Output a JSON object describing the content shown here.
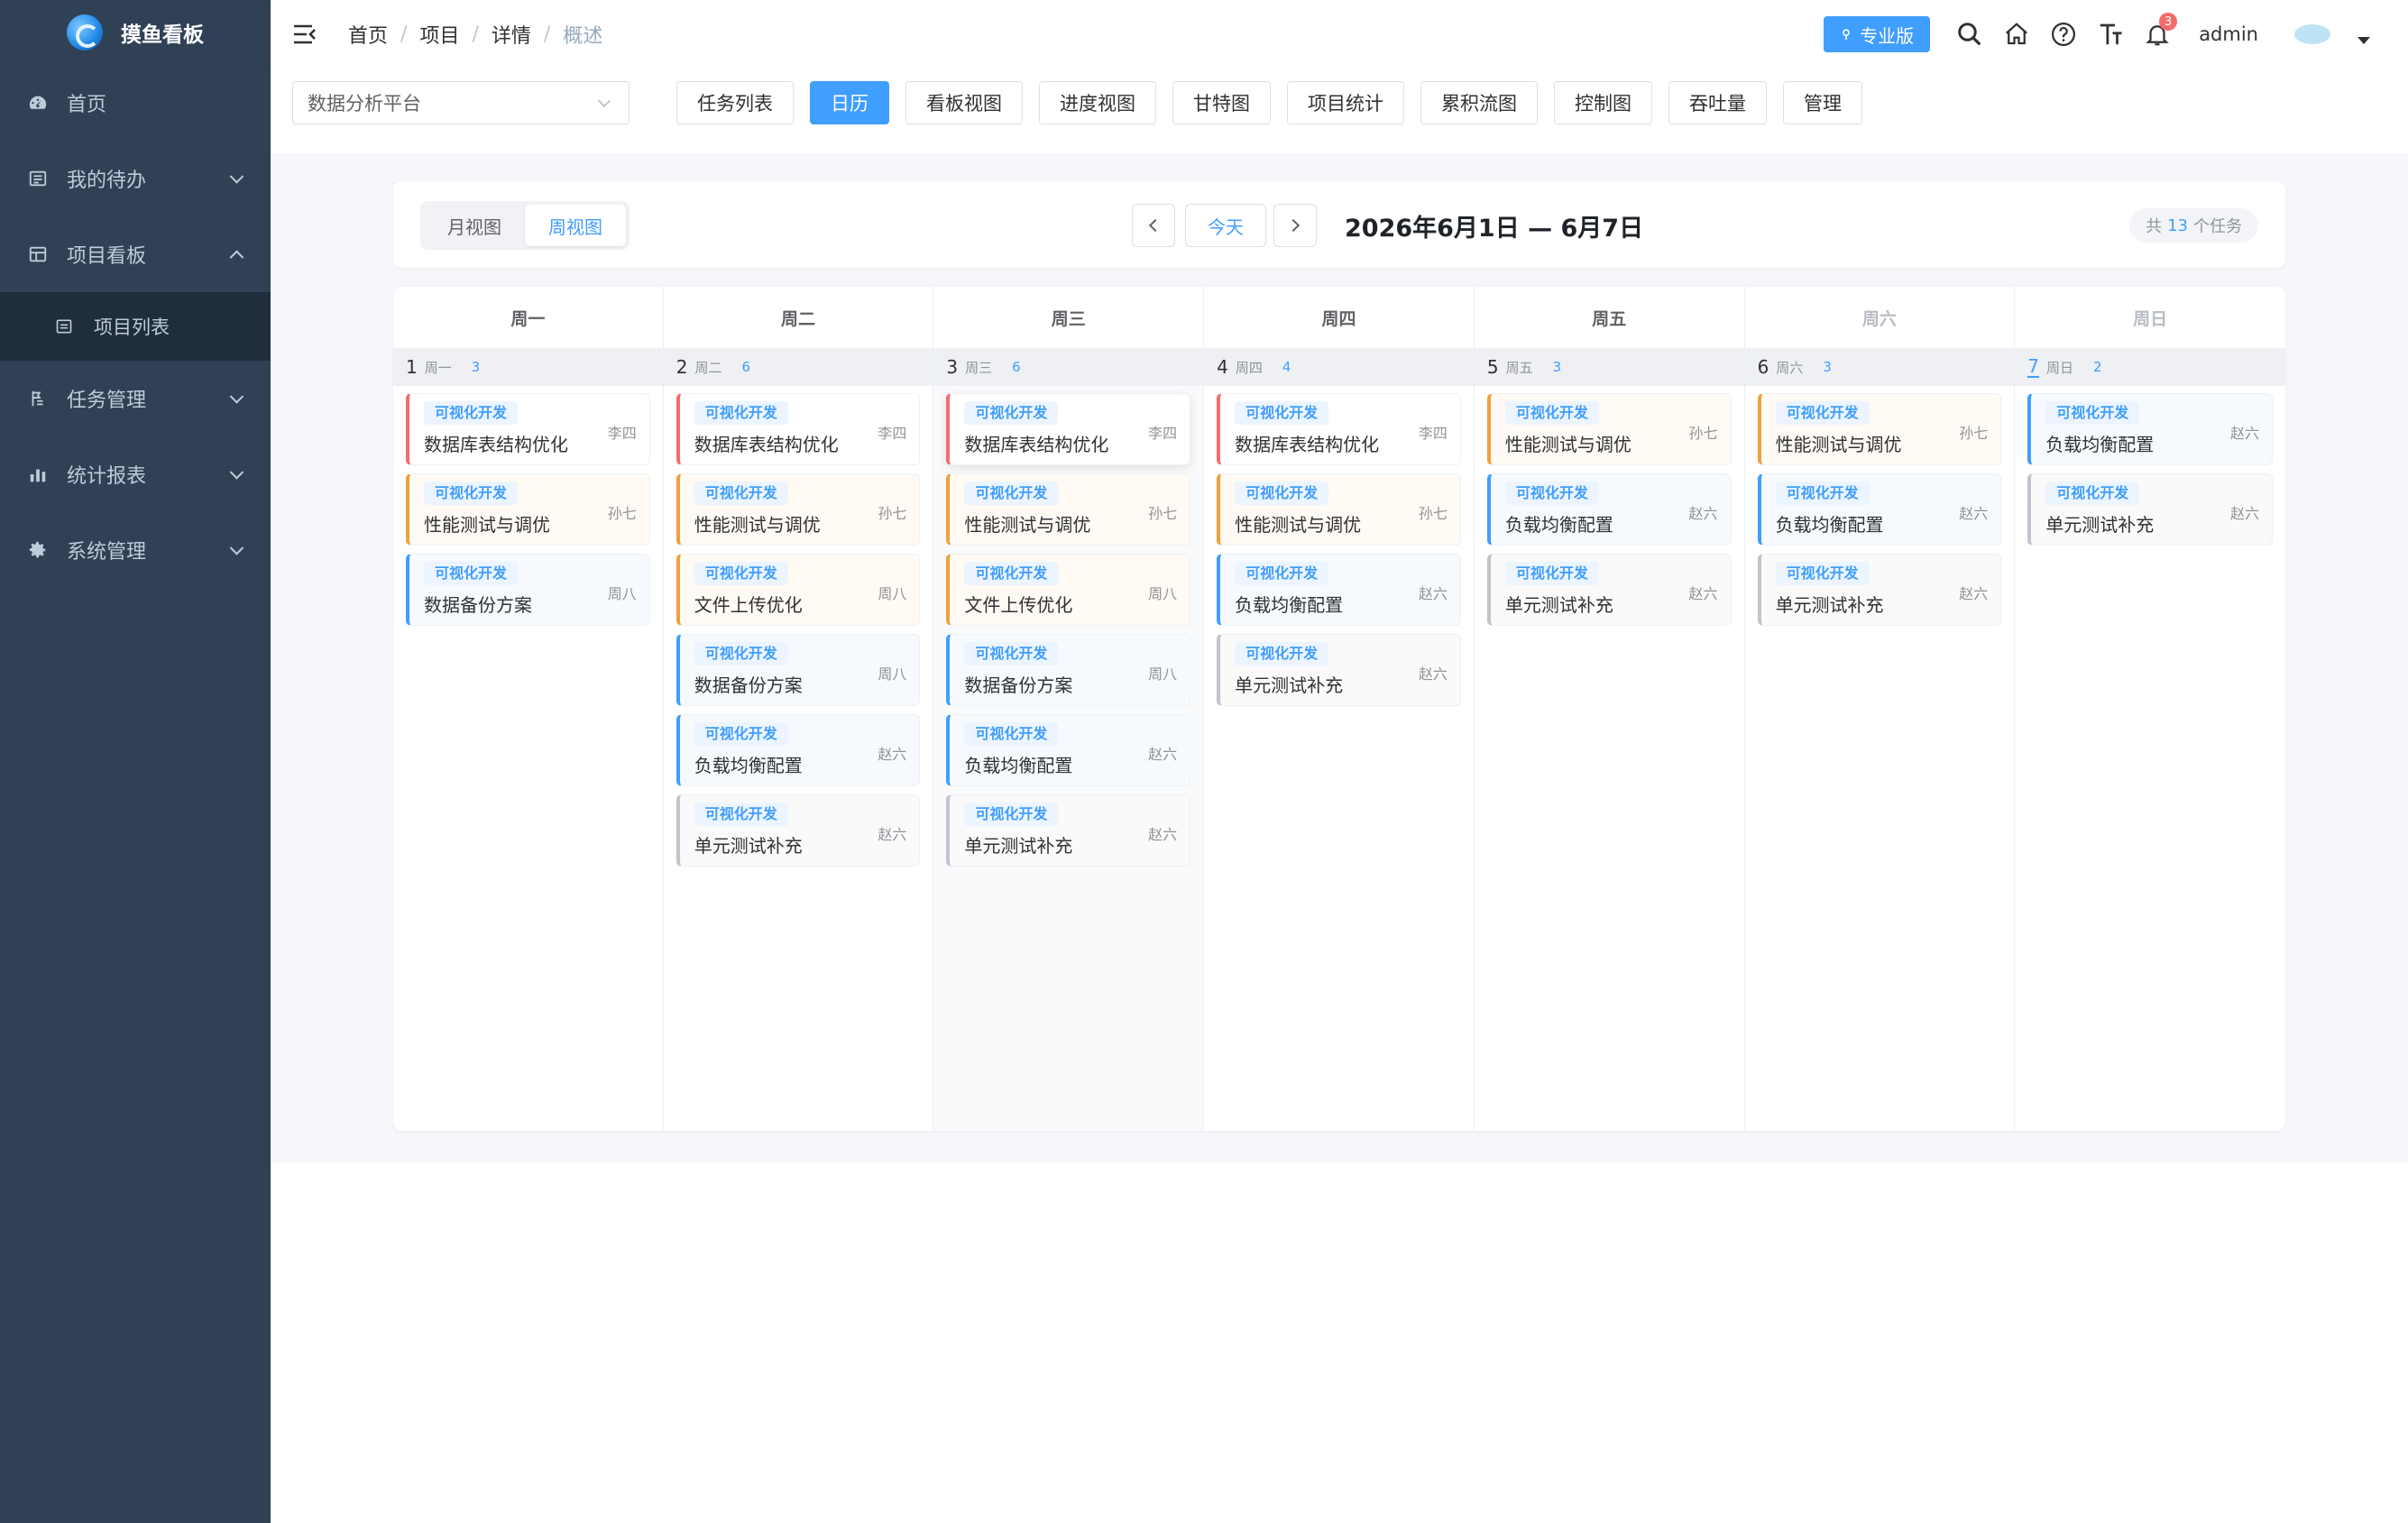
{
  "sidebar": {
    "logo_title": "摸鱼看板",
    "items": [
      {
        "label": "首页",
        "icon": "dashboard-icon"
      },
      {
        "label": "我的待办",
        "icon": "todo-icon"
      },
      {
        "label": "项目看板",
        "icon": "board-icon"
      },
      {
        "label": "项目列表",
        "icon": "list-icon"
      },
      {
        "label": "任务管理",
        "icon": "task-icon"
      },
      {
        "label": "统计报表",
        "icon": "chart-icon"
      },
      {
        "label": "系统管理",
        "icon": "gear-icon"
      }
    ]
  },
  "header": {
    "breadcrumb": [
      "首页",
      "项目",
      "详情",
      "概述"
    ],
    "separator": "/",
    "pro_label": "专业版",
    "notification_count": "3",
    "username": "admin"
  },
  "toolbar": {
    "project": "数据分析平台",
    "tabs": [
      "任务列表",
      "日历",
      "看板视图",
      "进度视图",
      "甘特图",
      "项目统计",
      "累积流图",
      "控制图",
      "吞吐量",
      "管理"
    ],
    "active_tab": "日历"
  },
  "calendar": {
    "view_month": "月视图",
    "view_week": "周视图",
    "active_view": "周视图",
    "today_label": "今天",
    "range": "2026年6月1日 — 6月7日",
    "count_prefix": "共",
    "count_value": "13",
    "count_suffix": "个任务",
    "days": [
      {
        "header": "周一",
        "date": "1",
        "weekday": "周一",
        "count": "3",
        "weekend": false,
        "current": false,
        "tasks": [
          {
            "tag": "可视化开发",
            "title": "数据库表结构优化",
            "assignee": "李四",
            "color": "#f56c6c"
          },
          {
            "tag": "可视化开发",
            "title": "性能测试与调优",
            "assignee": "孙七",
            "color": "#f0a13c"
          },
          {
            "tag": "可视化开发",
            "title": "数据备份方案",
            "assignee": "周八",
            "color": "#409eff"
          }
        ]
      },
      {
        "header": "周二",
        "date": "2",
        "weekday": "周二",
        "count": "6",
        "weekend": false,
        "current": false,
        "tasks": [
          {
            "tag": "可视化开发",
            "title": "数据库表结构优化",
            "assignee": "李四",
            "color": "#f56c6c"
          },
          {
            "tag": "可视化开发",
            "title": "性能测试与调优",
            "assignee": "孙七",
            "color": "#f0a13c"
          },
          {
            "tag": "可视化开发",
            "title": "文件上传优化",
            "assignee": "周八",
            "color": "#f0a13c"
          },
          {
            "tag": "可视化开发",
            "title": "数据备份方案",
            "assignee": "周八",
            "color": "#409eff"
          },
          {
            "tag": "可视化开发",
            "title": "负载均衡配置",
            "assignee": "赵六",
            "color": "#409eff"
          },
          {
            "tag": "可视化开发",
            "title": "单元测试补充",
            "assignee": "赵六",
            "color": "#c0c4cc"
          }
        ]
      },
      {
        "header": "周三",
        "date": "3",
        "weekday": "周三",
        "count": "6",
        "weekend": false,
        "current": false,
        "tasks": [
          {
            "tag": "可视化开发",
            "title": "数据库表结构优化",
            "assignee": "李四",
            "color": "#f56c6c"
          },
          {
            "tag": "可视化开发",
            "title": "性能测试与调优",
            "assignee": "孙七",
            "color": "#f0a13c"
          },
          {
            "tag": "可视化开发",
            "title": "文件上传优化",
            "assignee": "周八",
            "color": "#f0a13c"
          },
          {
            "tag": "可视化开发",
            "title": "数据备份方案",
            "assignee": "周八",
            "color": "#409eff"
          },
          {
            "tag": "可视化开发",
            "title": "负载均衡配置",
            "assignee": "赵六",
            "color": "#409eff"
          },
          {
            "tag": "可视化开发",
            "title": "单元测试补充",
            "assignee": "赵六",
            "color": "#c0c4cc"
          }
        ]
      },
      {
        "header": "周四",
        "date": "4",
        "weekday": "周四",
        "count": "4",
        "weekend": false,
        "current": false,
        "tasks": [
          {
            "tag": "可视化开发",
            "title": "数据库表结构优化",
            "assignee": "李四",
            "color": "#f56c6c"
          },
          {
            "tag": "可视化开发",
            "title": "性能测试与调优",
            "assignee": "孙七",
            "color": "#f0a13c"
          },
          {
            "tag": "可视化开发",
            "title": "负载均衡配置",
            "assignee": "赵六",
            "color": "#409eff"
          },
          {
            "tag": "可视化开发",
            "title": "单元测试补充",
            "assignee": "赵六",
            "color": "#c0c4cc"
          }
        ]
      },
      {
        "header": "周五",
        "date": "5",
        "weekday": "周五",
        "count": "3",
        "weekend": false,
        "current": false,
        "tasks": [
          {
            "tag": "可视化开发",
            "title": "性能测试与调优",
            "assignee": "孙七",
            "color": "#f0a13c"
          },
          {
            "tag": "可视化开发",
            "title": "负载均衡配置",
            "assignee": "赵六",
            "color": "#409eff"
          },
          {
            "tag": "可视化开发",
            "title": "单元测试补充",
            "assignee": "赵六",
            "color": "#c0c4cc"
          }
        ]
      },
      {
        "header": "周六",
        "date": "6",
        "weekday": "周六",
        "count": "3",
        "weekend": true,
        "current": false,
        "tasks": [
          {
            "tag": "可视化开发",
            "title": "性能测试与调优",
            "assignee": "孙七",
            "color": "#f0a13c"
          },
          {
            "tag": "可视化开发",
            "title": "负载均衡配置",
            "assignee": "赵六",
            "color": "#409eff"
          },
          {
            "tag": "可视化开发",
            "title": "单元测试补充",
            "assignee": "赵六",
            "color": "#c0c4cc"
          }
        ]
      },
      {
        "header": "周日",
        "date": "7",
        "weekday": "周日",
        "count": "2",
        "weekend": true,
        "current": true,
        "tasks": [
          {
            "tag": "可视化开发",
            "title": "负载均衡配置",
            "assignee": "赵六",
            "color": "#409eff"
          },
          {
            "tag": "可视化开发",
            "title": "单元测试补充",
            "assignee": "赵六",
            "color": "#c0c4cc"
          }
        ]
      }
    ]
  }
}
